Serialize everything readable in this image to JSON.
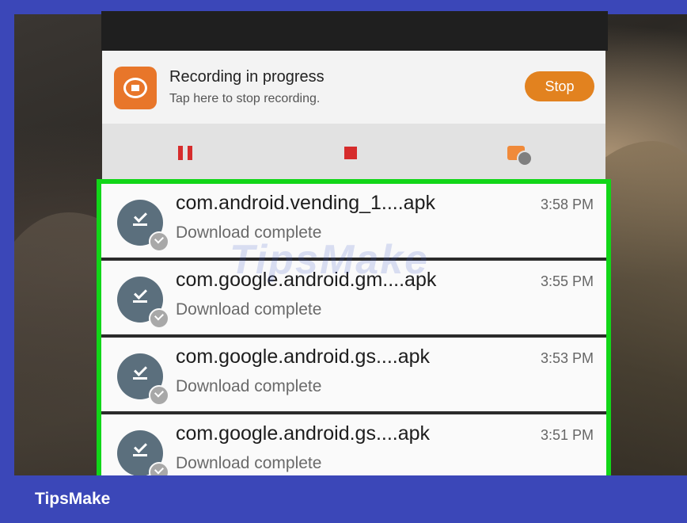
{
  "recording": {
    "title": "Recording in progress",
    "subtitle": "Tap here to stop recording.",
    "stop_label": "Stop",
    "accent_color": "#e2821f",
    "controls": [
      "pause-icon",
      "stop-icon",
      "camera-settings-icon"
    ]
  },
  "downloads": [
    {
      "name": "com.android.vending_1....apk",
      "status": "Download complete",
      "time": "3:58 PM"
    },
    {
      "name": "com.google.android.gm....apk",
      "status": "Download complete",
      "time": "3:55 PM"
    },
    {
      "name": "com.google.android.gs....apk",
      "status": "Download complete",
      "time": "3:53 PM"
    },
    {
      "name": "com.google.android.gs....apk",
      "status": "Download complete",
      "time": "3:51 PM"
    }
  ],
  "highlight_color": "#11d618",
  "watermark": "TipsMake",
  "footer": {
    "brand": "TipsMake"
  }
}
